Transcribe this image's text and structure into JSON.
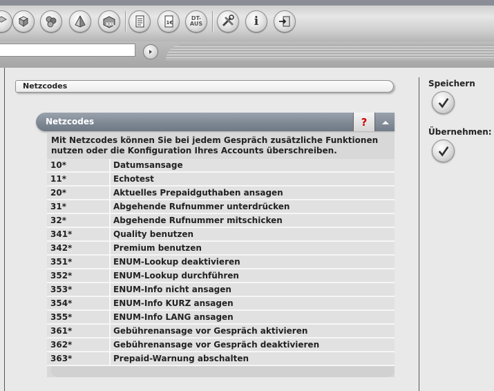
{
  "toolbar": {
    "icons": [
      {
        "name": "cube-outline-icon"
      },
      {
        "name": "cube-icon"
      },
      {
        "name": "cubes-icon"
      },
      {
        "name": "pyramid-icon"
      },
      {
        "name": "box-xxl-icon"
      },
      {
        "name": "document-icon"
      },
      {
        "name": "invoice-euro-icon"
      },
      {
        "name": "dt-aus-icon",
        "text": "DT-\nAUS"
      },
      {
        "name": "tools-icon"
      },
      {
        "name": "info-icon",
        "text": "i"
      },
      {
        "name": "exit-icon"
      }
    ],
    "search_value": ""
  },
  "breadcrumb": {
    "label": "Netzcodes"
  },
  "panel": {
    "title": "Netzcodes",
    "help_label": "?",
    "description": "Mit Netzcodes können Sie bei jedem Gespräch zusätzliche Funktionen nutzen oder die Konfiguration Ihres Accounts überschreiben.",
    "rows": [
      {
        "code": "10*",
        "desc": "Datumsansage"
      },
      {
        "code": "11*",
        "desc": "Echotest"
      },
      {
        "code": "20*",
        "desc": "Aktuelles Prepaidguthaben ansagen"
      },
      {
        "code": "31*",
        "desc": "Abgehende Rufnummer unterdrücken"
      },
      {
        "code": "32*",
        "desc": "Abgehende Rufnummer mitschicken"
      },
      {
        "code": "341*",
        "desc": "Quality benutzen"
      },
      {
        "code": "342*",
        "desc": "Premium benutzen"
      },
      {
        "code": "351*",
        "desc": "ENUM-Lookup deaktivieren"
      },
      {
        "code": "352*",
        "desc": "ENUM-Lookup durchführen"
      },
      {
        "code": "353*",
        "desc": "ENUM-Info nicht ansagen"
      },
      {
        "code": "354*",
        "desc": "ENUM-Info KURZ ansagen"
      },
      {
        "code": "355*",
        "desc": "ENUM-Info LANG ansagen"
      },
      {
        "code": "361*",
        "desc": "Gebührenansage vor Gespräch aktivieren"
      },
      {
        "code": "362*",
        "desc": "Gebührenansage vor Gespräch deaktivieren"
      },
      {
        "code": "363*",
        "desc": "Prepaid-Warnung abschalten"
      }
    ]
  },
  "actions": {
    "save_label": "Speichern",
    "apply_label": "Übernehmen:"
  },
  "colors": {
    "panel_header": "#7d8793",
    "help_mark": "#d00000",
    "row_bg": "#e1e1e1"
  }
}
